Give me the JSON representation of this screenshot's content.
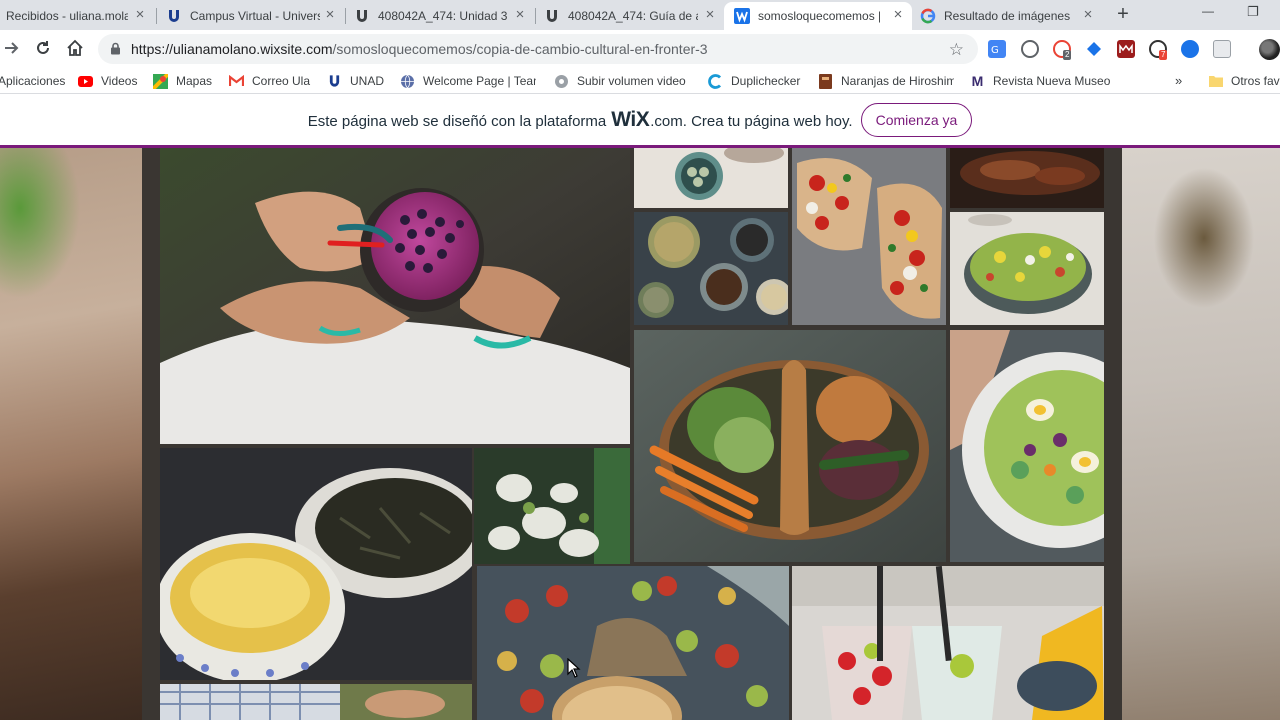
{
  "browser": {
    "tabs": [
      {
        "title": "Recibidos - uliana.molano",
        "active": false,
        "favicon": "gmail-icon"
      },
      {
        "title": "Campus Virtual - Universidad",
        "active": false,
        "favicon": "unad-icon"
      },
      {
        "title": "408042A_474: Unidad 3",
        "active": false,
        "favicon": "unad-icon"
      },
      {
        "title": "408042A_474: Guía de a",
        "active": false,
        "favicon": "unad-icon"
      },
      {
        "title": "somosloquecomemos |",
        "active": true,
        "favicon": "wix-icon"
      },
      {
        "title": "Resultado de imágenes",
        "active": false,
        "favicon": "google-icon"
      }
    ],
    "url": {
      "host": "https://ulianamolano.wixsite.com",
      "path": "/somosloquecomemos/copia-de-cambio-cultural-en-fronter-3"
    },
    "extensions": [
      {
        "icon": "translate-icon",
        "color": "#4285f4"
      },
      {
        "icon": "shield-icon",
        "color": "#5f6368"
      },
      {
        "icon": "notification-icon",
        "color": "#ea4335",
        "badge": "2"
      },
      {
        "icon": "diamond-icon",
        "color": "#1a73e8"
      },
      {
        "icon": "mendeley-icon",
        "color": "#9c1c1c"
      },
      {
        "icon": "adblock-icon",
        "color": "#333333",
        "badge": "7"
      },
      {
        "icon": "globe-icon",
        "color": "#1a73e8"
      },
      {
        "icon": "puzzle-icon",
        "color": "#9aa0a6"
      }
    ],
    "bookmarks": [
      {
        "label": "Aplicaciones",
        "icon": "apps-icon"
      },
      {
        "label": "Videos",
        "icon": "youtube-icon"
      },
      {
        "label": "Mapas",
        "icon": "maps-icon"
      },
      {
        "label": "Correo Ula",
        "icon": "gmail-icon"
      },
      {
        "label": "UNAD",
        "icon": "unad-icon"
      },
      {
        "label": "Welcome Page | Team",
        "icon": "globe-icon"
      },
      {
        "label": "Subir volumen video",
        "icon": "chrome-ext-icon"
      },
      {
        "label": "Duplichecker",
        "icon": "duplichecker-icon"
      },
      {
        "label": "Naranjas de Hiroshima",
        "icon": "book-icon"
      },
      {
        "label": "Revista Nueva Museo",
        "icon": "museo-icon"
      }
    ],
    "more_bookmarks": "»",
    "other_bookmarks": "Otros favoritos"
  },
  "wix_banner": {
    "text_before": "Este página web se diseñó con la plataforma",
    "logo": "WiX",
    "text_after": ".com. Crea tu página web hoy.",
    "button": "Comienza ya",
    "accent": "#7a1a7b"
  },
  "gallery": {
    "images": [
      {
        "subject": "smoothie-bowl"
      },
      {
        "subject": "bowl-of-eggs"
      },
      {
        "subject": "bruschetta"
      },
      {
        "subject": "grilled-meat"
      },
      {
        "subject": "seeds-and-spices"
      },
      {
        "subject": "green-salad"
      },
      {
        "subject": "vegetable-basket"
      },
      {
        "subject": "salad-plate"
      },
      {
        "subject": "green-tea"
      },
      {
        "subject": "white-flowers"
      },
      {
        "subject": "apples-and-pie"
      },
      {
        "subject": "cocktails"
      },
      {
        "subject": "gardener"
      }
    ]
  }
}
